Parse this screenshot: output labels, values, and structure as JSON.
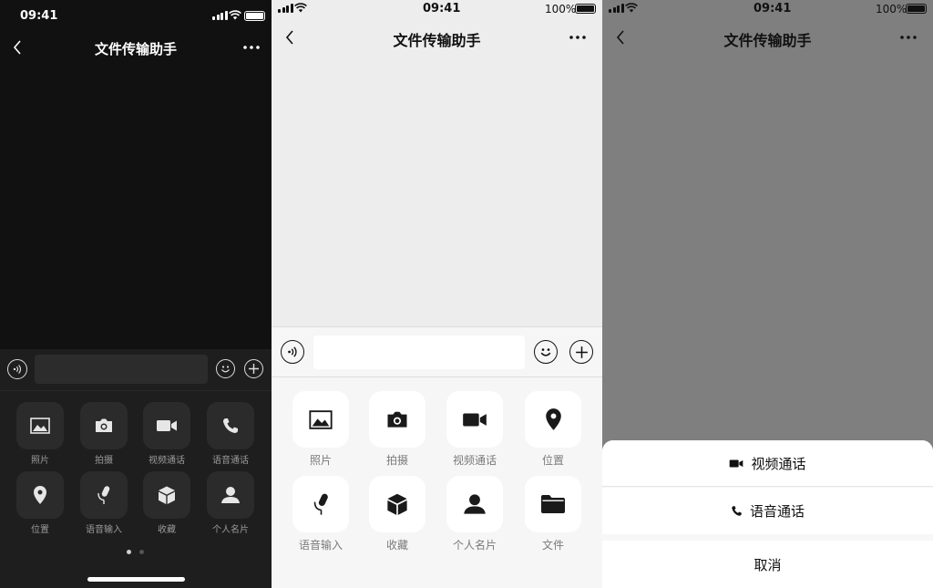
{
  "status_bar": {
    "time": "09:41",
    "battery_percent": "100%"
  },
  "nav": {
    "title": "文件传输助手"
  },
  "attachments_page1": [
    {
      "label": "照片",
      "icon": "photo-icon"
    },
    {
      "label": "拍摄",
      "icon": "camera-icon"
    },
    {
      "label": "视频通话",
      "icon": "video-call-icon"
    },
    {
      "label": "语音通话",
      "icon": "phone-icon"
    },
    {
      "label": "位置",
      "icon": "location-icon"
    },
    {
      "label": "语音输入",
      "icon": "microphone-icon"
    },
    {
      "label": "收藏",
      "icon": "cube-icon"
    },
    {
      "label": "个人名片",
      "icon": "contact-card-icon"
    }
  ],
  "attachments_light": [
    {
      "label": "照片",
      "icon": "photo-icon"
    },
    {
      "label": "拍摄",
      "icon": "camera-icon"
    },
    {
      "label": "视频通话",
      "icon": "video-call-icon"
    },
    {
      "label": "位置",
      "icon": "location-icon"
    },
    {
      "label": "语音输入",
      "icon": "microphone-icon"
    },
    {
      "label": "收藏",
      "icon": "cube-icon"
    },
    {
      "label": "个人名片",
      "icon": "contact-card-icon"
    },
    {
      "label": "文件",
      "icon": "folder-icon"
    }
  ],
  "pager": {
    "pages": 2,
    "current": 1
  },
  "action_sheet": {
    "video_call": "视频通话",
    "voice_call": "语音通话",
    "cancel": "取消"
  },
  "colors": {
    "dark_bg": "#111111",
    "light_bg": "#EDEDED",
    "overlay": "#7F7F7F"
  }
}
